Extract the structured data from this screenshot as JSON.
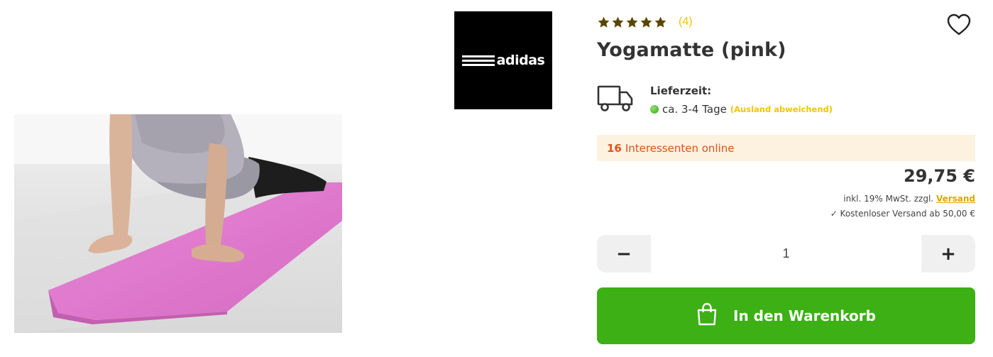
{
  "brand": {
    "logo_text": "adidas"
  },
  "rating": {
    "stars": 5,
    "review_count": "(4)"
  },
  "product": {
    "title": "Yogamatte (pink)"
  },
  "delivery": {
    "label": "Lieferzeit:",
    "time": "ca. 3-4 Tage",
    "note": "(Ausland abweichend)",
    "status_color": "#4caf50"
  },
  "interest": {
    "count": "16",
    "text": "Interessenten online"
  },
  "price": {
    "amount": "29,75 €",
    "tax_text": "inkl. 19% MwSt. zzgl.",
    "shipping_link": "Versand",
    "free_shipping": "✓ Kostenloser Versand ab 50,00 €"
  },
  "quantity": {
    "value": "1",
    "minus": "−",
    "plus": "+"
  },
  "cart": {
    "label": "In den Warenkorb"
  },
  "colors": {
    "accent_green": "#3cb014",
    "star_color": "#5a4600",
    "highlight_yellow": "#f5c500",
    "interest_orange": "#e0531a"
  },
  "icons": [
    "star-icon",
    "heart-icon",
    "truck-icon",
    "status-dot-icon",
    "shopping-bag-icon"
  ]
}
